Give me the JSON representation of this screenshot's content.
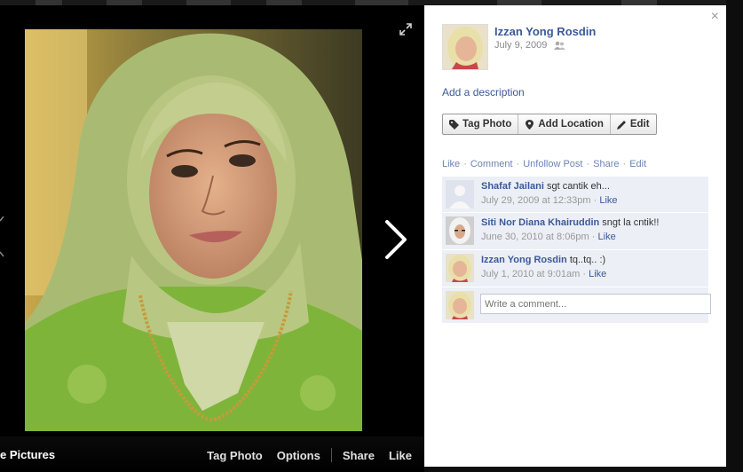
{
  "viewer": {
    "album_link": "e Pictures",
    "bottom_actions": {
      "tag_photo": "Tag Photo",
      "options": "Options",
      "share": "Share",
      "like": "Like"
    }
  },
  "panel": {
    "close": "×",
    "owner": {
      "name": "Izzan Yong Rosdin",
      "date": "July 9, 2009"
    },
    "add_description": "Add a description",
    "buttons": {
      "tag_photo": "Tag Photo",
      "add_location": "Add Location",
      "edit": "Edit"
    },
    "actions": {
      "like": "Like",
      "comment": "Comment",
      "unfollow": "Unfollow Post",
      "share": "Share",
      "edit": "Edit",
      "dot": "·"
    },
    "comments": [
      {
        "name": "Shafaf Jailani",
        "text": "sgt cantik eh...",
        "time": "July 29, 2009 at 12:33pm",
        "like": "Like"
      },
      {
        "name": "Siti Nor Diana Khairuddin",
        "text": "sngt la cntik!!",
        "time": "June 30, 2010 at 8:06pm",
        "like": "Like"
      },
      {
        "name": "Izzan Yong Rosdin",
        "text": "tq..tq.. :)",
        "time": "July 1, 2010 at 9:01am",
        "like": "Like"
      }
    ],
    "write_comment_placeholder": "Write a comment..."
  },
  "colors": {
    "link_blue": "#3b5998",
    "muted_link": "#6d84b4",
    "comment_bg": "#eceff5"
  }
}
